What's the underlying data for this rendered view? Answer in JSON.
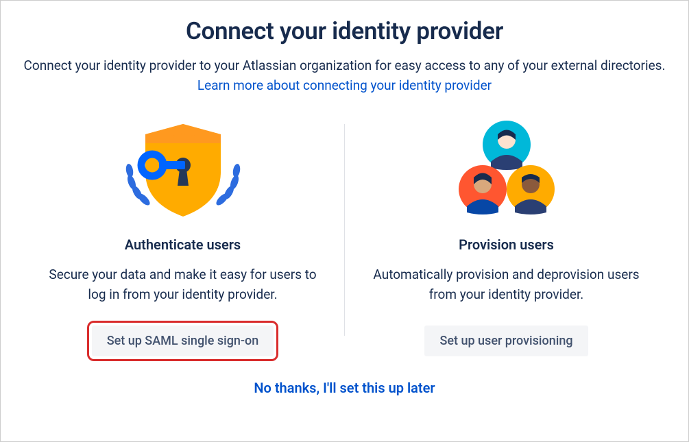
{
  "header": {
    "title": "Connect your identity provider",
    "subtitle_prefix": "Connect your identity provider to your Atlassian organization for easy access to any of your external directories. ",
    "learn_more_link": "Learn more about connecting your identity provider"
  },
  "cards": {
    "authenticate": {
      "title": "Authenticate users",
      "description": "Secure your data and make it easy for users to log in from your identity provider.",
      "button_label": "Set up SAML single sign-on"
    },
    "provision": {
      "title": "Provision users",
      "description": "Automatically provision and deprovision users from your identity provider.",
      "button_label": "Set up user provisioning"
    }
  },
  "footer": {
    "skip_label": "No thanks, I'll set this up later"
  }
}
